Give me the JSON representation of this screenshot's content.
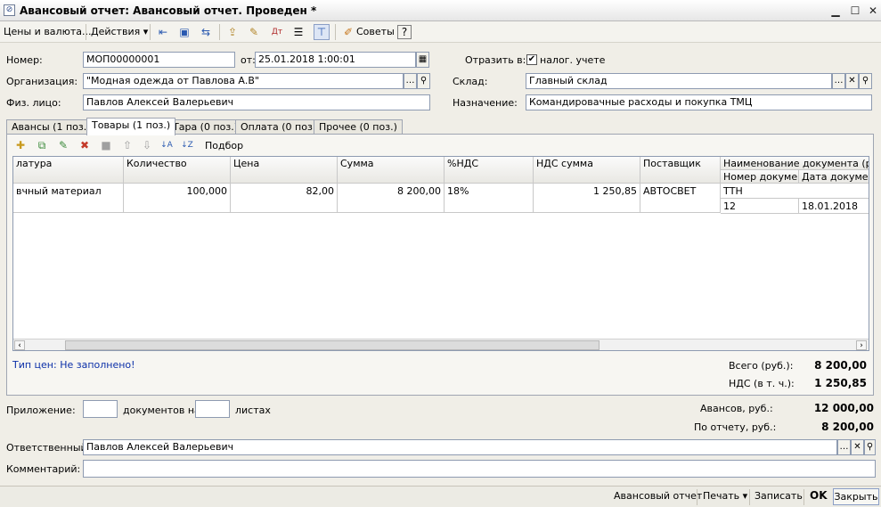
{
  "window": {
    "title": "Авансовый отчет: Авансовый отчет. Проведен *"
  },
  "toolbar": {
    "prices_label": "Цены и валюта...",
    "actions_label": "Действия",
    "advice_label": "Советы"
  },
  "form": {
    "number_label": "Номер:",
    "number_value": "МОП00000001",
    "from_label": "от:",
    "date_value": "25.01.2018  1:00:01",
    "reflect_label": "Отразить в:",
    "tax_label": "налог. учете",
    "org_label": "Организация:",
    "org_value": "\"Модная одежда от Павлова А.В\"",
    "warehouse_label": "Склад:",
    "warehouse_value": "Главный склад",
    "person_label": "Физ. лицо:",
    "person_value": "Павлов Алексей Валерьевич",
    "purpose_label": "Назначение:",
    "purpose_value": "Командировачные расходы и покупка ТМЦ"
  },
  "tabs": [
    {
      "label": "Авансы (1 поз.)"
    },
    {
      "label": "Товары (1 поз.)"
    },
    {
      "label": "Тара (0 поз.)"
    },
    {
      "label": "Оплата (0 поз.)"
    },
    {
      "label": "Прочее (0 поз.)"
    }
  ],
  "grid_toolbar": {
    "selection_label": "Подбор"
  },
  "grid": {
    "headers": {
      "nomenclature": "латура",
      "quantity": "Количество",
      "price": "Цена",
      "sum": "Сумма",
      "vat_pct": "%НДС",
      "vat_sum": "НДС сумма",
      "supplier": "Поставщик",
      "doc_name": "Наименование документа (рас...",
      "doc_number": "Номер докуме...",
      "doc_date": "Дата докуме..."
    },
    "row": {
      "nomenclature": "вчный материал",
      "quantity": "100,000",
      "price": "82,00",
      "sum": "8 200,00",
      "vat_pct": "18%",
      "vat_sum": "1 250,85",
      "supplier": "АВТОСВЕТ",
      "doc_name": "ТТН",
      "doc_number": "12",
      "doc_date": "18.01.2018"
    }
  },
  "panel_footer": {
    "price_type": "Тип цен: Не заполнено!",
    "total_label": "Всего (руб.):",
    "total_value": "8 200,00",
    "vat_label": "НДС (в т. ч.):",
    "vat_value": "1 250,85"
  },
  "bottom": {
    "attachment_label": "Приложение:",
    "documents_on_label": "документов на",
    "sheets_label": "листах",
    "advances_label": "Авансов, руб.:",
    "advances_value": "12 000,00",
    "by_report_label": "По отчету, руб.:",
    "by_report_value": "8 200,00",
    "responsible_label": "Ответственный:",
    "responsible_value": "Павлов Алексей Валерьевич",
    "comment_label": "Комментарий:",
    "comment_value": ""
  },
  "statusbar": {
    "report_label": "Авансовый отчет",
    "print_label": "Печать",
    "save_label": "Записать",
    "ok_label": "OK",
    "close_label": "Закрыть"
  },
  "colors": {
    "link_blue": "#0b2fa8",
    "background": "#f0eee7"
  }
}
